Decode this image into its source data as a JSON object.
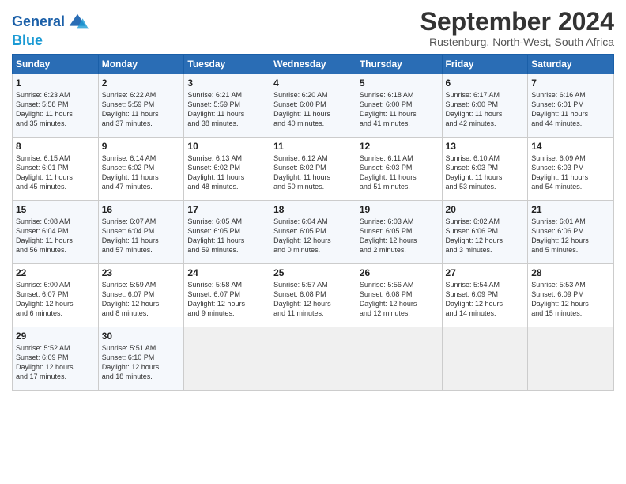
{
  "header": {
    "logo_line1": "General",
    "logo_line2": "Blue",
    "month": "September 2024",
    "location": "Rustenburg, North-West, South Africa"
  },
  "weekdays": [
    "Sunday",
    "Monday",
    "Tuesday",
    "Wednesday",
    "Thursday",
    "Friday",
    "Saturday"
  ],
  "weeks": [
    [
      {
        "day": "1",
        "sunrise": "6:23 AM",
        "sunset": "5:58 PM",
        "daylight": "11 hours and 35 minutes."
      },
      {
        "day": "2",
        "sunrise": "6:22 AM",
        "sunset": "5:59 PM",
        "daylight": "11 hours and 37 minutes."
      },
      {
        "day": "3",
        "sunrise": "6:21 AM",
        "sunset": "5:59 PM",
        "daylight": "11 hours and 38 minutes."
      },
      {
        "day": "4",
        "sunrise": "6:20 AM",
        "sunset": "6:00 PM",
        "daylight": "11 hours and 40 minutes."
      },
      {
        "day": "5",
        "sunrise": "6:18 AM",
        "sunset": "6:00 PM",
        "daylight": "11 hours and 41 minutes."
      },
      {
        "day": "6",
        "sunrise": "6:17 AM",
        "sunset": "6:00 PM",
        "daylight": "11 hours and 42 minutes."
      },
      {
        "day": "7",
        "sunrise": "6:16 AM",
        "sunset": "6:01 PM",
        "daylight": "11 hours and 44 minutes."
      }
    ],
    [
      {
        "day": "8",
        "sunrise": "6:15 AM",
        "sunset": "6:01 PM",
        "daylight": "11 hours and 45 minutes."
      },
      {
        "day": "9",
        "sunrise": "6:14 AM",
        "sunset": "6:02 PM",
        "daylight": "11 hours and 47 minutes."
      },
      {
        "day": "10",
        "sunrise": "6:13 AM",
        "sunset": "6:02 PM",
        "daylight": "11 hours and 48 minutes."
      },
      {
        "day": "11",
        "sunrise": "6:12 AM",
        "sunset": "6:02 PM",
        "daylight": "11 hours and 50 minutes."
      },
      {
        "day": "12",
        "sunrise": "6:11 AM",
        "sunset": "6:03 PM",
        "daylight": "11 hours and 51 minutes."
      },
      {
        "day": "13",
        "sunrise": "6:10 AM",
        "sunset": "6:03 PM",
        "daylight": "11 hours and 53 minutes."
      },
      {
        "day": "14",
        "sunrise": "6:09 AM",
        "sunset": "6:03 PM",
        "daylight": "11 hours and 54 minutes."
      }
    ],
    [
      {
        "day": "15",
        "sunrise": "6:08 AM",
        "sunset": "6:04 PM",
        "daylight": "11 hours and 56 minutes."
      },
      {
        "day": "16",
        "sunrise": "6:07 AM",
        "sunset": "6:04 PM",
        "daylight": "11 hours and 57 minutes."
      },
      {
        "day": "17",
        "sunrise": "6:05 AM",
        "sunset": "6:05 PM",
        "daylight": "11 hours and 59 minutes."
      },
      {
        "day": "18",
        "sunrise": "6:04 AM",
        "sunset": "6:05 PM",
        "daylight": "12 hours and 0 minutes."
      },
      {
        "day": "19",
        "sunrise": "6:03 AM",
        "sunset": "6:05 PM",
        "daylight": "12 hours and 2 minutes."
      },
      {
        "day": "20",
        "sunrise": "6:02 AM",
        "sunset": "6:06 PM",
        "daylight": "12 hours and 3 minutes."
      },
      {
        "day": "21",
        "sunrise": "6:01 AM",
        "sunset": "6:06 PM",
        "daylight": "12 hours and 5 minutes."
      }
    ],
    [
      {
        "day": "22",
        "sunrise": "6:00 AM",
        "sunset": "6:07 PM",
        "daylight": "12 hours and 6 minutes."
      },
      {
        "day": "23",
        "sunrise": "5:59 AM",
        "sunset": "6:07 PM",
        "daylight": "12 hours and 8 minutes."
      },
      {
        "day": "24",
        "sunrise": "5:58 AM",
        "sunset": "6:07 PM",
        "daylight": "12 hours and 9 minutes."
      },
      {
        "day": "25",
        "sunrise": "5:57 AM",
        "sunset": "6:08 PM",
        "daylight": "12 hours and 11 minutes."
      },
      {
        "day": "26",
        "sunrise": "5:56 AM",
        "sunset": "6:08 PM",
        "daylight": "12 hours and 12 minutes."
      },
      {
        "day": "27",
        "sunrise": "5:54 AM",
        "sunset": "6:09 PM",
        "daylight": "12 hours and 14 minutes."
      },
      {
        "day": "28",
        "sunrise": "5:53 AM",
        "sunset": "6:09 PM",
        "daylight": "12 hours and 15 minutes."
      }
    ],
    [
      {
        "day": "29",
        "sunrise": "5:52 AM",
        "sunset": "6:09 PM",
        "daylight": "12 hours and 17 minutes."
      },
      {
        "day": "30",
        "sunrise": "5:51 AM",
        "sunset": "6:10 PM",
        "daylight": "12 hours and 18 minutes."
      },
      null,
      null,
      null,
      null,
      null
    ]
  ]
}
